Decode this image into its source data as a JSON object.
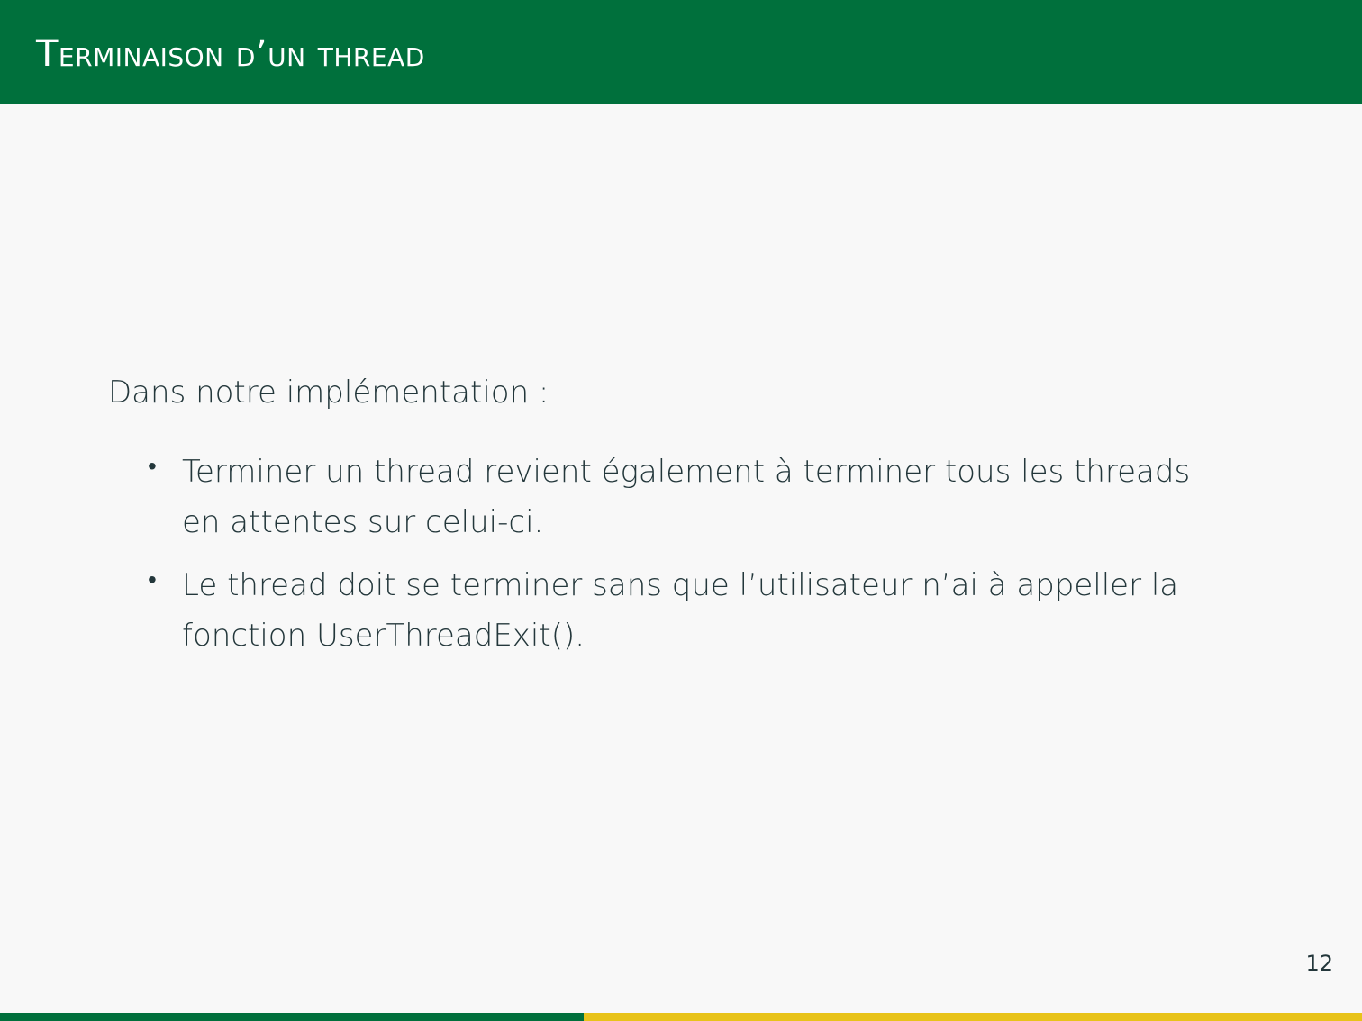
{
  "slide": {
    "title": "Terminaison d’un thread",
    "intro": "Dans notre implémentation :",
    "bullets": [
      {
        "marker": "•",
        "text": "Terminer un thread revient également à terminer tous les threads en attentes sur celui-ci."
      },
      {
        "marker": "•",
        "text": "Le thread doit se terminer sans que l’utilisateur n’ai à appeller la fonction UserThreadExit()."
      }
    ],
    "page_number": "12"
  },
  "colors": {
    "header_bg": "#00703c",
    "footer_left": "#00703c",
    "footer_right": "#e8c31a",
    "text": "#23373b",
    "background": "#f8f8f8"
  }
}
